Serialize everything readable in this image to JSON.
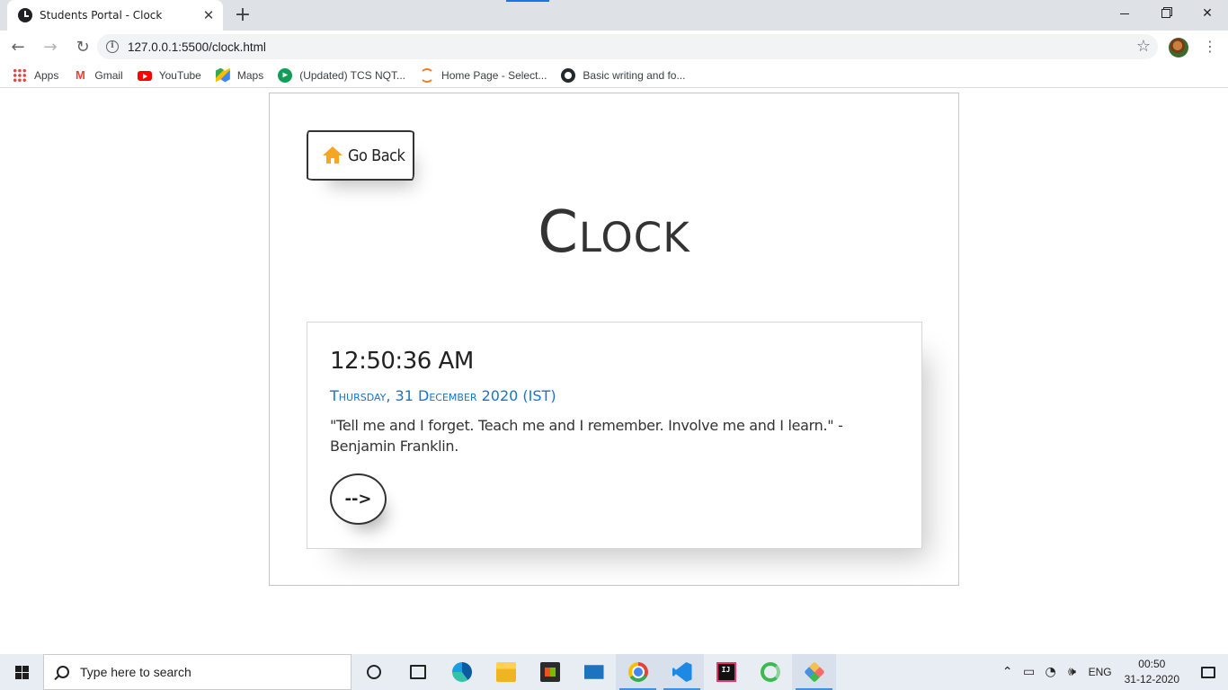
{
  "browser": {
    "tab_title": "Students Portal - Clock",
    "tab_close_glyph": "✕",
    "new_tab_glyph": "+",
    "url": "127.0.0.1:5500/clock.html",
    "back_glyph": "←",
    "forward_glyph": "→",
    "reload_glyph": "↻",
    "star_glyph": "☆",
    "menu_glyph": "⋮",
    "close_glyph": "✕",
    "info_glyph": "i"
  },
  "bookmarks": [
    {
      "label": "Apps",
      "icon": "apps-grid-icon"
    },
    {
      "label": "Gmail",
      "icon": "gmail-icon"
    },
    {
      "label": "YouTube",
      "icon": "youtube-icon"
    },
    {
      "label": "Maps",
      "icon": "maps-icon"
    },
    {
      "label": "(Updated) TCS NQT...",
      "icon": "tcs-icon"
    },
    {
      "label": "Home Page - Select...",
      "icon": "home-page-icon"
    },
    {
      "label": "Basic writing and fo...",
      "icon": "github-icon"
    }
  ],
  "page": {
    "go_back_label": "Go Back",
    "title": "Clock",
    "time": "12:50:36 AM",
    "date": "Thursday, 31 December 2020 (IST)",
    "quote": "\"Tell me and I forget. Teach me and I remember. Involve me and I learn.\" - Benjamin Franklin.",
    "next_label": "-->",
    "colors": {
      "date_blue": "#1a73c8",
      "home_icon_orange": "#f5a623",
      "text_dark": "#333333"
    }
  },
  "taskbar": {
    "search_placeholder": "Type here to search",
    "language": "ENG",
    "time": "00:50",
    "date": "31-12-2020",
    "apps": [
      "cortana-icon",
      "task-view-icon",
      "edge-icon",
      "file-explorer-icon",
      "store-icon",
      "mail-icon",
      "chrome-icon",
      "vscode-icon",
      "intellij-icon",
      "spinner-app-icon",
      "gitkraken-icon"
    ]
  }
}
